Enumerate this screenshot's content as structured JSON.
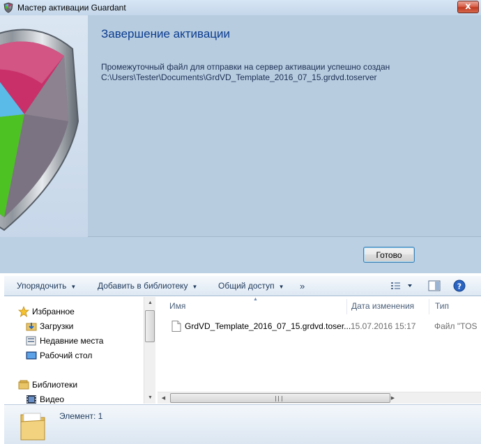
{
  "wizard": {
    "title": "Мастер активации Guardant",
    "page_title": "Завершение активации",
    "message_line1": "Промежуточный файл для отправки на сервер активации успешно создан",
    "message_line2": "C:\\Users\\Tester\\Documents\\GrdVD_Template_2016_07_15.grdvd.toserver",
    "close_glyph": "x",
    "done_label": "Готово",
    "icons": {
      "app": "guardant-shield-icon",
      "banner": "shield-illustration",
      "close": "close-icon"
    },
    "colors": {
      "title_text": "#0b3c8f",
      "panel": "#b7ccdf",
      "close_button": "#c13a20"
    }
  },
  "explorer": {
    "toolbar": {
      "organize": "Упорядочить",
      "add_to_library": "Добавить в библиотеку",
      "share": "Общий доступ",
      "more": "»",
      "icons": [
        "views-icon",
        "preview-pane-icon",
        "help-icon"
      ]
    },
    "nav": {
      "favorites": "Избранное",
      "downloads": "Загрузки",
      "recent_places": "Недавние места",
      "desktop": "Рабочий стол",
      "libraries": "Библиотеки",
      "videos": "Видео"
    },
    "columns": {
      "name": "Имя",
      "date_modified": "Дата изменения",
      "type": "Тип"
    },
    "files": [
      {
        "name": "GrdVD_Template_2016_07_15.grdvd.toser...",
        "date": "15.07.2016 15:17",
        "type": "Файл \"TOS"
      }
    ],
    "details": {
      "count": "Элемент: 1"
    }
  }
}
